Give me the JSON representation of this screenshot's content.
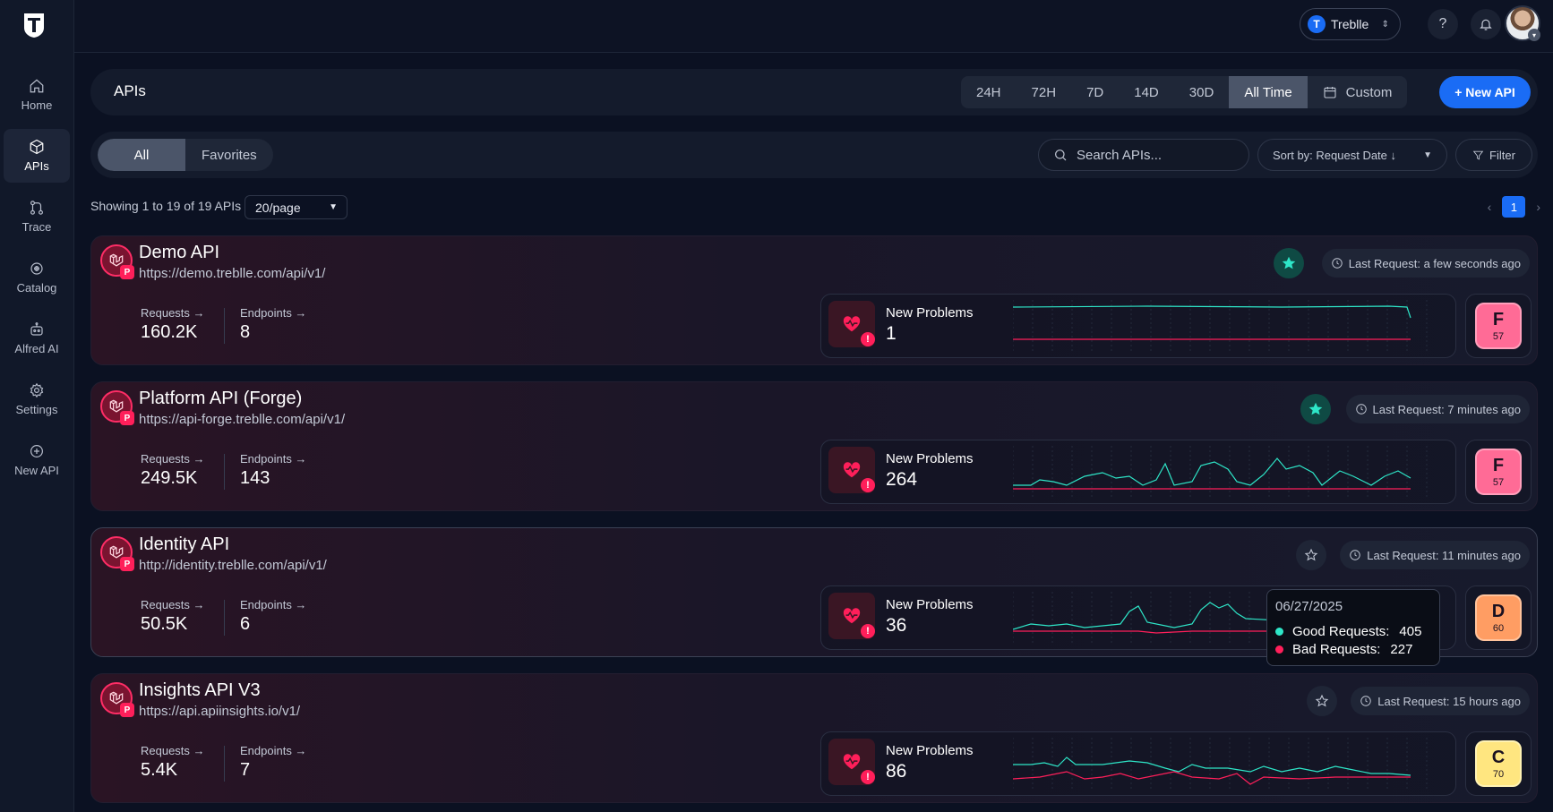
{
  "sidebar": {
    "items": [
      {
        "label": "Home",
        "icon": "home-icon"
      },
      {
        "label": "APIs",
        "icon": "apis-icon",
        "active": true
      },
      {
        "label": "Trace",
        "icon": "trace-icon"
      },
      {
        "label": "Catalog",
        "icon": "catalog-icon"
      },
      {
        "label": "Alfred AI",
        "icon": "robot-icon"
      },
      {
        "label": "Settings",
        "icon": "gear-icon"
      },
      {
        "label": "New API",
        "icon": "plus-circle-icon"
      }
    ]
  },
  "topbar": {
    "workspace": "Treblle",
    "help_icon": "?",
    "bell_icon": "bell-icon"
  },
  "header": {
    "title": "APIs",
    "ranges": [
      "24H",
      "72H",
      "7D",
      "14D",
      "30D",
      "All Time",
      "Custom"
    ],
    "active_range": "All Time",
    "new_api": "+ New API"
  },
  "filters": {
    "segments": [
      "All",
      "Favorites"
    ],
    "active_segment": "All",
    "search_placeholder": "Search APIs...",
    "sort_label": "Sort by: Request Date ↓",
    "filter_label": "Filter"
  },
  "listing": {
    "showing": "Showing 1 to 19 of 19 APIs",
    "per_page": "20/page",
    "page": "1"
  },
  "apis": [
    {
      "name": "Demo API",
      "url": "https://demo.treblle.com/api/v1/",
      "favorite": true,
      "last_request": "Last Request: a few seconds ago",
      "requests_label": "Requests →",
      "requests": "160.2K",
      "endpoints_label": "Endpoints →",
      "endpoints": "8",
      "problems_label": "New Problems",
      "problems": "1",
      "grade": "F",
      "score": "57"
    },
    {
      "name": "Platform API (Forge)",
      "url": "https://api-forge.treblle.com/api/v1/",
      "favorite": true,
      "last_request": "Last Request: 7 minutes ago",
      "requests_label": "Requests →",
      "requests": "249.5K",
      "endpoints_label": "Endpoints →",
      "endpoints": "143",
      "problems_label": "New Problems",
      "problems": "264",
      "grade": "F",
      "score": "57"
    },
    {
      "name": "Identity API",
      "url": "http://identity.treblle.com/api/v1/",
      "favorite": false,
      "last_request": "Last Request: 11 minutes ago",
      "requests_label": "Requests →",
      "requests": "50.5K",
      "endpoints_label": "Endpoints →",
      "endpoints": "6",
      "problems_label": "New Problems",
      "problems": "36",
      "grade": "D",
      "score": "60"
    },
    {
      "name": "Insights API V3",
      "url": "https://api.apiinsights.io/v1/",
      "favorite": false,
      "last_request": "Last Request: 15 hours ago",
      "requests_label": "Requests →",
      "requests": "5.4K",
      "endpoints_label": "Endpoints →",
      "endpoints": "7",
      "problems_label": "New Problems",
      "problems": "86",
      "grade": "C",
      "score": "70"
    }
  ],
  "tooltip": {
    "date": "06/27/2025",
    "good_label": "Good Requests:",
    "good_value": "405",
    "bad_label": "Bad Requests:",
    "bad_value": "227"
  },
  "colors": {
    "accent": "#1a6cf5",
    "good": "#2ee6c8",
    "bad": "#ff1f5a"
  }
}
